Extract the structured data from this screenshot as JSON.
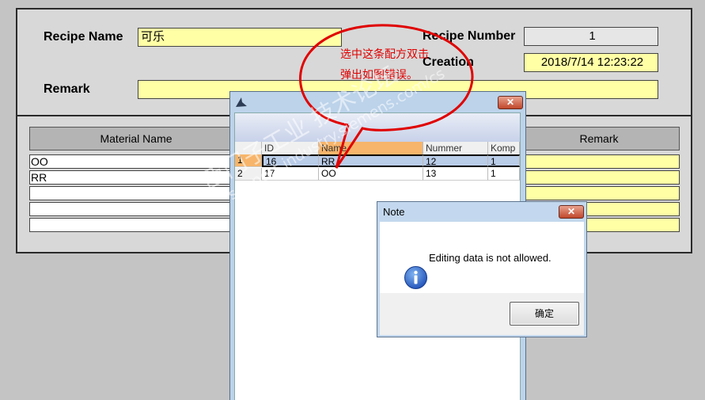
{
  "recipe": {
    "name_label": "Recipe Name",
    "name_value": "可乐",
    "number_label": "Recipe Number",
    "number_value": "1",
    "creation_label": "Creation",
    "creation_value": "2018/7/14 12:23:22",
    "remark_label": "Remark",
    "remark_value": ""
  },
  "materials": {
    "col_material": "Material Name",
    "col_remark": "Remark",
    "rows": [
      "OO",
      "RR",
      "",
      "",
      ""
    ]
  },
  "annotation": {
    "line1": "选中这条配方双击",
    "line2": "弹出如图错误。"
  },
  "selection_window": {
    "close_glyph": "✕",
    "columns": [
      "ID",
      "Name",
      "Nummer",
      "Komp"
    ],
    "rows": [
      {
        "row": "1",
        "id": "16",
        "name": "RR",
        "nummer": "12",
        "komp": "1"
      },
      {
        "row": "2",
        "id": "17",
        "name": "OO",
        "nummer": "13",
        "komp": "1"
      }
    ]
  },
  "note_dialog": {
    "title": "Note",
    "close_glyph": "✕",
    "message": "Editing data is not allowed.",
    "ok_label": "确定"
  },
  "watermark": {
    "line1": "西门子工业 技术论坛",
    "line2": "support.industry.siemens.com/cs"
  },
  "colors": {
    "field_yellow": "#ffffa6",
    "panel_grey": "#d8d8d8",
    "annotation_red": "#e00000",
    "selected_header": "#f7b56b"
  }
}
